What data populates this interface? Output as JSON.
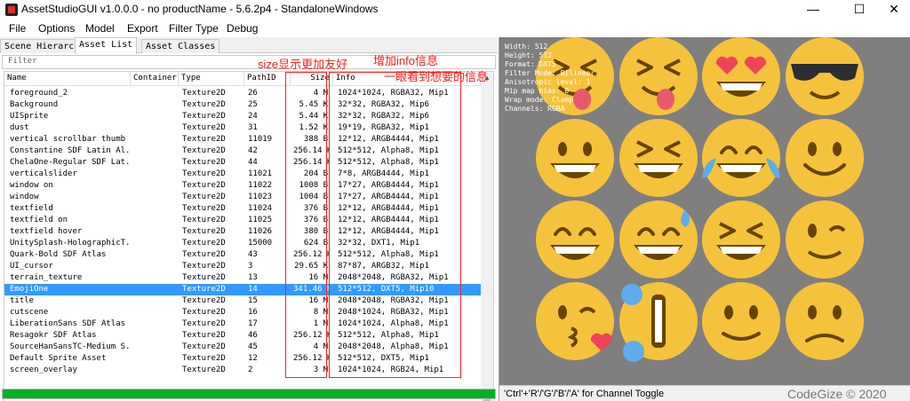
{
  "window": {
    "title": "AssetStudioGUI v1.0.0.0 - no productName - 5.6.2p4 - StandaloneWindows",
    "minimize": "—",
    "maximize": "☐",
    "close": "✕"
  },
  "menu": [
    "File",
    "Options",
    "Model",
    "Export",
    "Filter Type",
    "Debug"
  ],
  "tabs": [
    {
      "label": "Scene Hierarchy",
      "active": false
    },
    {
      "label": "Asset List",
      "active": true
    },
    {
      "label": "Asset Classes",
      "active": false
    }
  ],
  "filter": {
    "placeholder": "Filter"
  },
  "columns": [
    "Name",
    "Container",
    "Type",
    "PathID",
    "Size",
    "Info"
  ],
  "rows": [
    {
      "name": "foreground_2",
      "container": "",
      "type": "Texture2D",
      "pathid": "26",
      "size": "4 M",
      "info": "1024*1024, RGBA32, Mip1"
    },
    {
      "name": "Background",
      "container": "",
      "type": "Texture2D",
      "pathid": "25",
      "size": "5.45 K",
      "info": "32*32, RGBA32, Mip6"
    },
    {
      "name": "UISprite",
      "container": "",
      "type": "Texture2D",
      "pathid": "24",
      "size": "5.44 K",
      "info": "32*32, RGBA32, Mip6"
    },
    {
      "name": "dust",
      "container": "",
      "type": "Texture2D",
      "pathid": "31",
      "size": "1.52 K",
      "info": "19*19, RGBA32, Mip1"
    },
    {
      "name": "vertical scrollbar thumb",
      "container": "",
      "type": "Texture2D",
      "pathid": "11019",
      "size": "388 B",
      "info": "12*12, ARGB4444, Mip1"
    },
    {
      "name": "Constantine SDF Latin Al...",
      "container": "",
      "type": "Texture2D",
      "pathid": "42",
      "size": "256.14 K",
      "info": "512*512, Alpha8, Mip1"
    },
    {
      "name": "ChelaOne-Regular SDF Lat...",
      "container": "",
      "type": "Texture2D",
      "pathid": "44",
      "size": "256.14 K",
      "info": "512*512, Alpha8, Mip1"
    },
    {
      "name": "verticalslider",
      "container": "",
      "type": "Texture2D",
      "pathid": "11021",
      "size": "204 B",
      "info": "7*8, ARGB4444, Mip1"
    },
    {
      "name": "window on",
      "container": "",
      "type": "Texture2D",
      "pathid": "11022",
      "size": "1008 B",
      "info": "17*27, ARGB4444, Mip1"
    },
    {
      "name": "window",
      "container": "",
      "type": "Texture2D",
      "pathid": "11023",
      "size": "1004 B",
      "info": "17*27, ARGB4444, Mip1"
    },
    {
      "name": "textfield",
      "container": "",
      "type": "Texture2D",
      "pathid": "11024",
      "size": "376 B",
      "info": "12*12, ARGB4444, Mip1"
    },
    {
      "name": "textfield on",
      "container": "",
      "type": "Texture2D",
      "pathid": "11025",
      "size": "376 B",
      "info": "12*12, ARGB4444, Mip1"
    },
    {
      "name": "textfield hover",
      "container": "",
      "type": "Texture2D",
      "pathid": "11026",
      "size": "380 B",
      "info": "12*12, ARGB4444, Mip1"
    },
    {
      "name": "UnitySplash-HolographicT...",
      "container": "",
      "type": "Texture2D",
      "pathid": "15000",
      "size": "624 B",
      "info": "32*32, DXT1, Mip1"
    },
    {
      "name": "Quark-Bold SDF Atlas",
      "container": "",
      "type": "Texture2D",
      "pathid": "43",
      "size": "256.12 K",
      "info": "512*512, Alpha8, Mip1"
    },
    {
      "name": "UI_cursor",
      "container": "",
      "type": "Texture2D",
      "pathid": "3",
      "size": "29.65 K",
      "info": "87*87, ARGB32, Mip1"
    },
    {
      "name": "terrain_texture",
      "container": "",
      "type": "Texture2D",
      "pathid": "13",
      "size": "16 M",
      "info": "2048*2048, RGBA32, Mip1"
    },
    {
      "name": "EmojiOne",
      "container": "",
      "type": "Texture2D",
      "pathid": "14",
      "size": "341.46 K",
      "info": "512*512, DXT5, Mip10",
      "selected": true
    },
    {
      "name": "title",
      "container": "",
      "type": "Texture2D",
      "pathid": "15",
      "size": "16 M",
      "info": "2048*2048, RGBA32, Mip1"
    },
    {
      "name": "cutscene",
      "container": "",
      "type": "Texture2D",
      "pathid": "16",
      "size": "8 M",
      "info": "2048*1024, RGBA32, Mip1"
    },
    {
      "name": "LiberationSans SDF Atlas",
      "container": "",
      "type": "Texture2D",
      "pathid": "17",
      "size": "1 M",
      "info": "1024*1024, Alpha8, Mip1"
    },
    {
      "name": "Resagokr SDF Atlas",
      "container": "",
      "type": "Texture2D",
      "pathid": "46",
      "size": "256.12 K",
      "info": "512*512, Alpha8, Mip1"
    },
    {
      "name": "SourceHanSansTC-Medium S...",
      "container": "",
      "type": "Texture2D",
      "pathid": "45",
      "size": "4 M",
      "info": "2048*2048, Alpha8, Mip1"
    },
    {
      "name": "Default Sprite Asset",
      "container": "",
      "type": "Texture2D",
      "pathid": "12",
      "size": "256.12 K",
      "info": "512*512, DXT5, Mip1"
    },
    {
      "name": "screen_overlay",
      "container": "",
      "type": "Texture2D",
      "pathid": "2",
      "size": "3 M",
      "info": "1024*1024, RGB24, Mip1"
    }
  ],
  "annotations": {
    "size_note": "size显示更加友好",
    "info_note_1": "增加info信息",
    "info_note_2": "一眼看到想要的信息"
  },
  "progress": {
    "value": 1.0,
    "color": "#06b025"
  },
  "preview": {
    "info_lines": [
      "Width: 512",
      "Height: 512",
      "Format: DXT5",
      "Filter Mode: Bilinear",
      "Anisotropic level: 1",
      "Mip map bias: 0",
      "Wrap mode: Clamp",
      "Channels: RGBA"
    ],
    "status": "'Ctrl'+'R'/'G'/'B'/'A' for Channel Toggle",
    "watermark": "CodeGize © 2020",
    "background_color": "#7f7f7f",
    "face_color": "#f5c33b",
    "feature_color": "#664500",
    "emojis": [
      "tongue-wink-face",
      "heart-eyes-face",
      "sunglasses-face",
      "grinning-face",
      "grin-face",
      "joy-face",
      "smile-face",
      "smiling-face",
      "sweat-smile-face",
      "laughing-face",
      "wink-face",
      "kissing-heart-face",
      "rolling-laughing-face",
      "slight-smile-face",
      "slight-frown-face"
    ]
  }
}
